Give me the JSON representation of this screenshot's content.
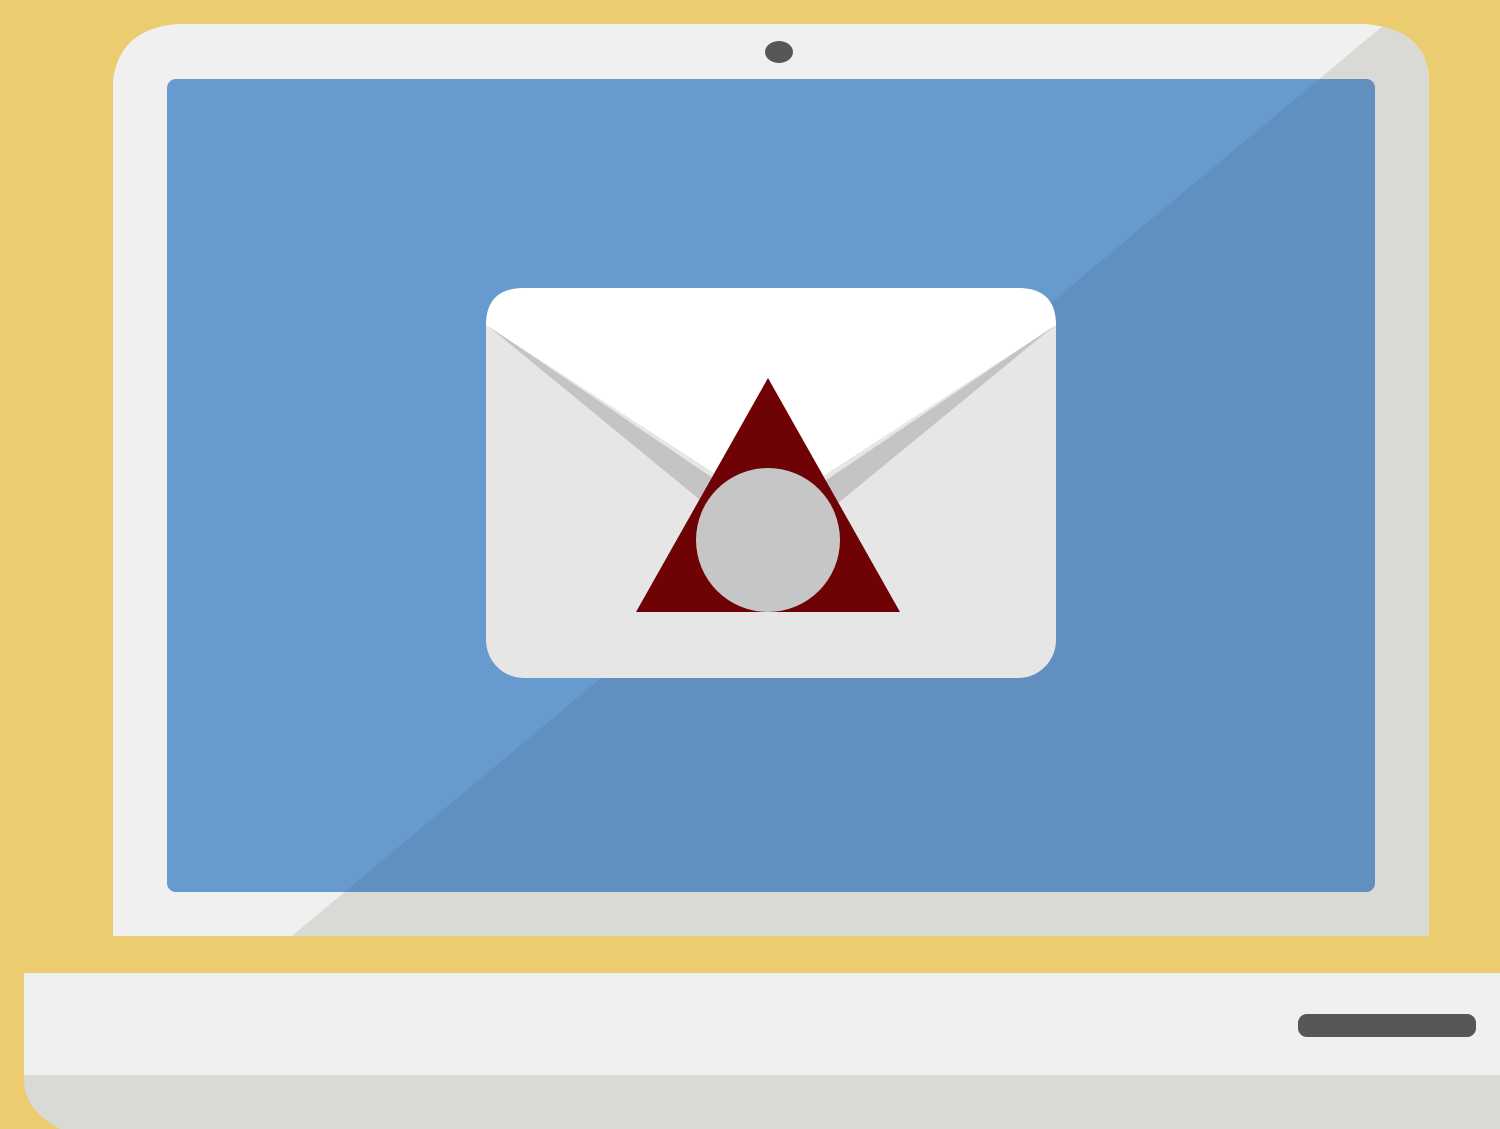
{
  "scene": {
    "subject": "laptop-with-envelope-icon",
    "icons": [
      "laptop-icon",
      "webcam-icon",
      "envelope-icon",
      "triangle-seal-icon",
      "circle-seal-icon",
      "trackpad-slot-icon"
    ]
  },
  "colors": {
    "background": "#EBCC6E",
    "bezel_light": "#F0F0F0",
    "bezel_shadow": "#D9D9D5",
    "screen": "#679ACE",
    "screen_shadow": "#618FC0",
    "webcam": "#575757",
    "envelope_body": "#E6E6E6",
    "envelope_flap": "#FFFFFF",
    "envelope_fold": "#C4C4C4",
    "seal_triangle": "#6E0204",
    "seal_circle": "#C6C6C6",
    "base_light": "#F0F0F0",
    "base_shadow": "#D9D9D5",
    "slot": "#575757"
  }
}
